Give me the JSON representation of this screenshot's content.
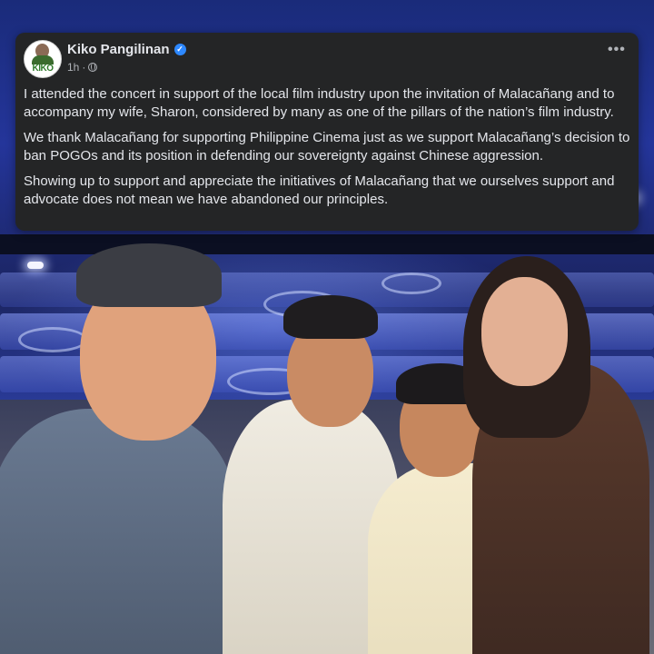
{
  "post": {
    "author_name": "Kiko Pangilinan",
    "avatar_label": "KIKO",
    "verified_icon": "verified-badge-icon",
    "time": "1h",
    "separator": "·",
    "audience_icon": "globe-icon",
    "more_icon": "more-options-icon",
    "paragraphs": [
      "I attended the concert in support of the local film industry upon the invitation of Malacañang and to accompany my wife, Sharon, considered by many as one of the pillars of the nation’s film industry.",
      "We thank Malacañang for supporting Philippine Cinema just as we support Malacañang’s  decision to ban POGOs and its position in defending our sovereignty against Chinese aggression.",
      "Showing up to support and appreciate the initiatives of Malacañang that we ourselves support and advocate does not mean we have abandoned our principles."
    ]
  },
  "colors": {
    "card_bg": "#242526",
    "text_primary": "#e4e6eb",
    "text_secondary": "#b0b3b8",
    "verified_blue": "#2d88ff",
    "stage_blue": "#2a3b98"
  }
}
